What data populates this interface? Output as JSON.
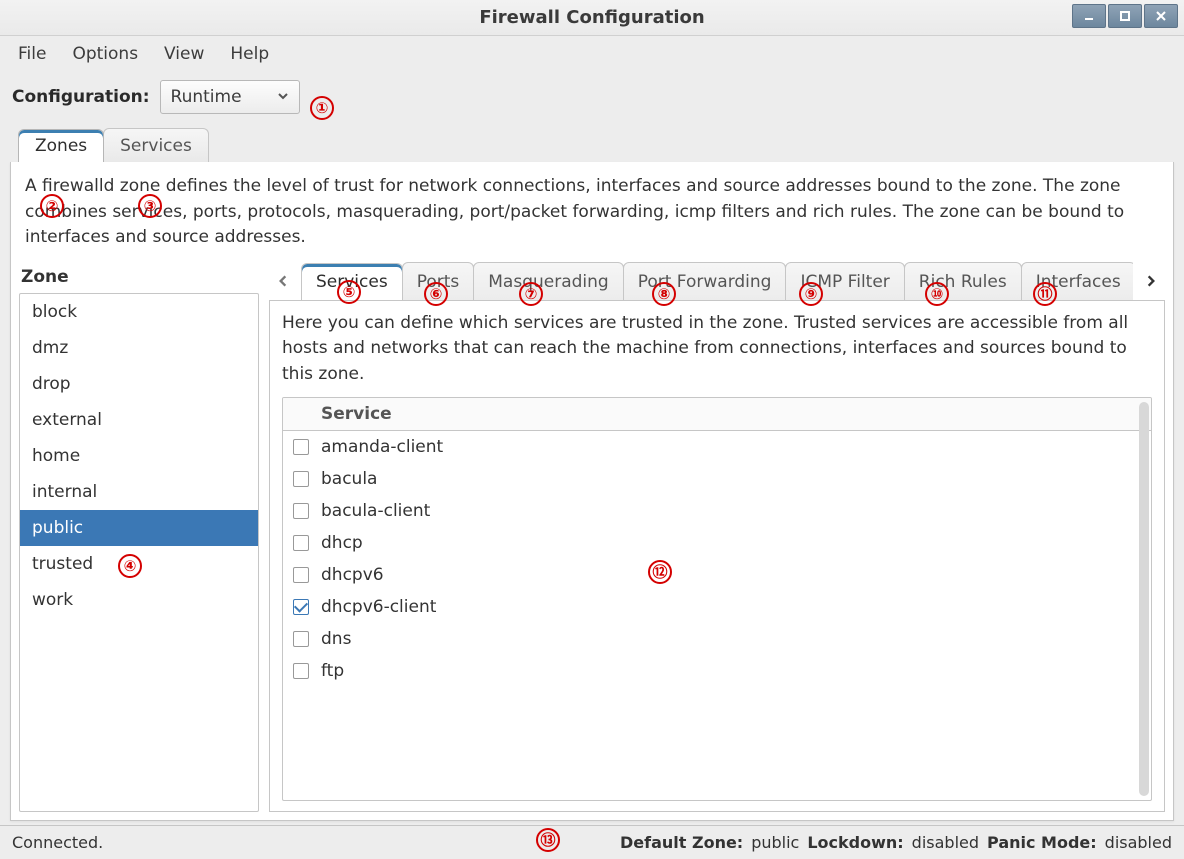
{
  "window": {
    "title": "Firewall Configuration"
  },
  "menu": {
    "file": "File",
    "options": "Options",
    "view": "View",
    "help": "Help"
  },
  "config": {
    "label": "Configuration:",
    "value": "Runtime"
  },
  "top_tabs": {
    "zones": "Zones",
    "services": "Services"
  },
  "zone_desc": "A firewalld zone defines the level of trust for network connections, interfaces and source addresses bound to the zone. The zone combines services, ports, protocols, masquerading, port/packet forwarding, icmp filters and rich rules. The zone can be bound to interfaces and source addresses.",
  "zone_label": "Zone",
  "zones": [
    {
      "name": "block"
    },
    {
      "name": "dmz"
    },
    {
      "name": "drop"
    },
    {
      "name": "external"
    },
    {
      "name": "home"
    },
    {
      "name": "internal"
    },
    {
      "name": "public",
      "selected": true
    },
    {
      "name": "trusted"
    },
    {
      "name": "work"
    }
  ],
  "inner_tabs": {
    "services": "Services",
    "ports": "Ports",
    "masquerading": "Masquerading",
    "port_forwarding": "Port Forwarding",
    "icmp_filter": "ICMP Filter",
    "rich_rules": "Rich Rules",
    "interfaces": "Interfaces"
  },
  "svc_desc": "Here you can define which services are trusted in the zone. Trusted services are accessible from all hosts and networks that can reach the machine from connections, interfaces and sources bound to this zone.",
  "svc_header": "Service",
  "services_list": [
    {
      "name": "amanda-client",
      "checked": false
    },
    {
      "name": "bacula",
      "checked": false
    },
    {
      "name": "bacula-client",
      "checked": false
    },
    {
      "name": "dhcp",
      "checked": false
    },
    {
      "name": "dhcpv6",
      "checked": false
    },
    {
      "name": "dhcpv6-client",
      "checked": true
    },
    {
      "name": "dns",
      "checked": false
    },
    {
      "name": "ftp",
      "checked": false
    }
  ],
  "status": {
    "connected": "Connected.",
    "default_zone_label": "Default Zone:",
    "default_zone_value": "public",
    "lockdown_label": "Lockdown:",
    "lockdown_value": "disabled",
    "panic_label": "Panic Mode:",
    "panic_value": "disabled"
  },
  "annotations": [
    "①",
    "②",
    "③",
    "④",
    "⑤",
    "⑥",
    "⑦",
    "⑧",
    "⑨",
    "⑩",
    "⑪",
    "⑫",
    "⑬"
  ]
}
